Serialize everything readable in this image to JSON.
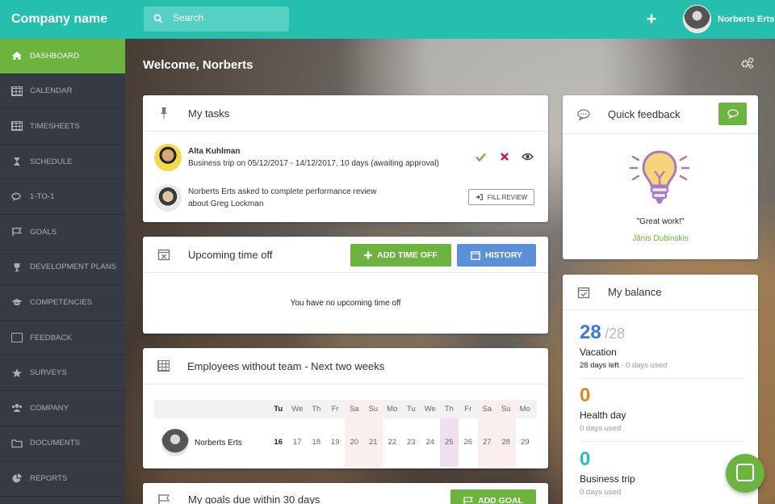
{
  "topbar": {
    "brand": "Company name",
    "search_placeholder": "Search",
    "user_name": "Norberts Erts"
  },
  "sidebar": {
    "items": [
      {
        "label": "Dashboard",
        "icon": "home-icon",
        "active": true
      },
      {
        "label": "Calendar",
        "icon": "calendar-icon"
      },
      {
        "label": "Timesheets",
        "icon": "table-icon"
      },
      {
        "label": "Schedule",
        "icon": "hourglass-icon"
      },
      {
        "label": "1-to-1",
        "icon": "chat-icon"
      },
      {
        "label": "Goals",
        "icon": "flag-icon"
      },
      {
        "label": "Development plans",
        "icon": "trophy-icon"
      },
      {
        "label": "Competencies",
        "icon": "graduation-cap-icon"
      },
      {
        "label": "Feedback",
        "icon": "feedback-icon"
      },
      {
        "label": "Surveys",
        "icon": "star-icon"
      },
      {
        "label": "Company",
        "icon": "users-icon"
      },
      {
        "label": "Documents",
        "icon": "folder-icon"
      },
      {
        "label": "Reports",
        "icon": "pie-chart-icon"
      }
    ]
  },
  "main": {
    "welcome": "Welcome, Norberts"
  },
  "tasks": {
    "title": "My tasks",
    "items": [
      {
        "name": "Alta Kuhlman",
        "text": "Business trip on 05/12/2017 - 14/12/2017, 10 days (awaiting approval)"
      },
      {
        "line1": "Norberts Erts asked to complete performance review",
        "line2": "about Greg Lockman",
        "action": "Fill review"
      }
    ]
  },
  "timeoff": {
    "title": "Upcoming time off",
    "add_label": "Add time off",
    "history_label": "History",
    "empty": "You have no upcoming time off"
  },
  "noteam": {
    "title": "Employees without team - Next two weeks",
    "days": [
      "Tu",
      "We",
      "Th",
      "Fr",
      "Sa",
      "Su",
      "Mo",
      "Tu",
      "We",
      "Th",
      "Fr",
      "Sa",
      "Su",
      "Mo"
    ],
    "dates": [
      "16",
      "17",
      "18",
      "19",
      "20",
      "21",
      "22",
      "23",
      "24",
      "25",
      "26",
      "27",
      "28",
      "29"
    ],
    "employee": "Norberts Erts"
  },
  "goals": {
    "title": "My goals due within 30 days",
    "add_label": "Add goal"
  },
  "feedback": {
    "title": "Quick feedback",
    "quote": "\"Great work!\"",
    "author": "Jānis Dubinskis"
  },
  "balance": {
    "title": "My balance",
    "items": [
      {
        "value": "28",
        "total": "/28",
        "label": "Vacation",
        "left": "28 days left",
        "used": " · 0 days used",
        "color": "#3a7bd5"
      },
      {
        "value": "0",
        "label": "Health day",
        "used": "0 days used",
        "color": "#e08a1e"
      },
      {
        "value": "0",
        "label": "Business trip",
        "used": "0 days used",
        "color": "#26bfc8"
      }
    ]
  }
}
